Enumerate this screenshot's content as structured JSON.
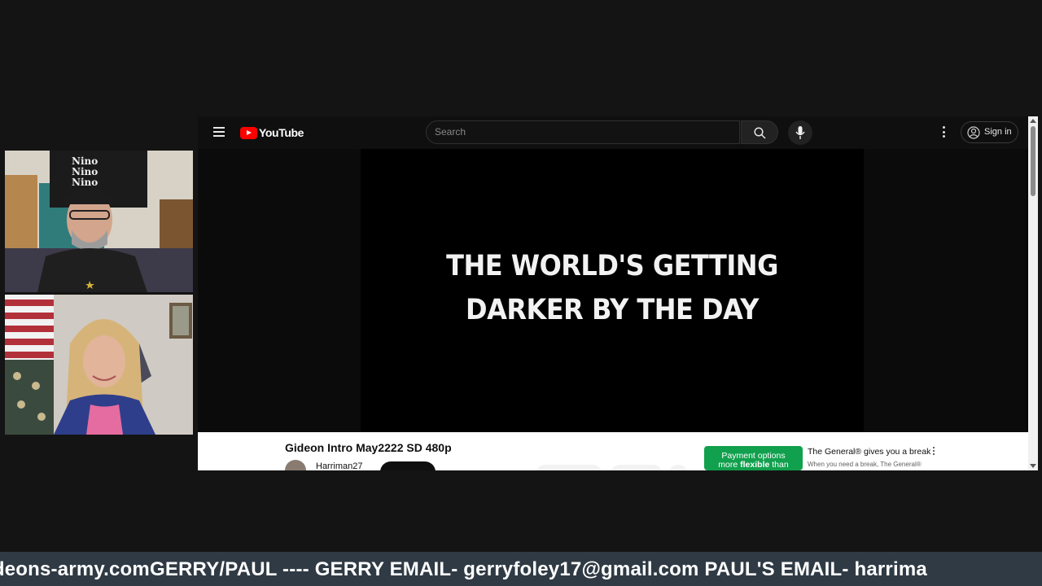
{
  "youtube": {
    "logo_text": "YouTube",
    "search_placeholder": "Search",
    "signin_label": "Sign in",
    "video_caption_line1": "THE WORLD'S GETTING",
    "video_caption_line2": "DARKER BY THE DAY",
    "video_title": "Gideon Intro May2222 SD 480p",
    "channel_name": "Harriman27",
    "ad": {
      "button_line1": "Payment options",
      "button_line2_pre": "more ",
      "button_line2_bold": "flexible",
      "button_line2_post": " than",
      "title": "The General® gives you a break",
      "subtitle": "When you need a break, The General®"
    }
  },
  "shirt_text": "Nino",
  "ticker": {
    "text": "ideons-army.comGERRY/PAUL ---- GERRY EMAIL- gerryfoley17@gmail.com PAUL'S EMAIL- harrima"
  },
  "colors": {
    "background": "#141414",
    "youtube_red": "#ff0000",
    "ad_green": "#11a04d",
    "ticker_bg": "#2f3a44"
  }
}
